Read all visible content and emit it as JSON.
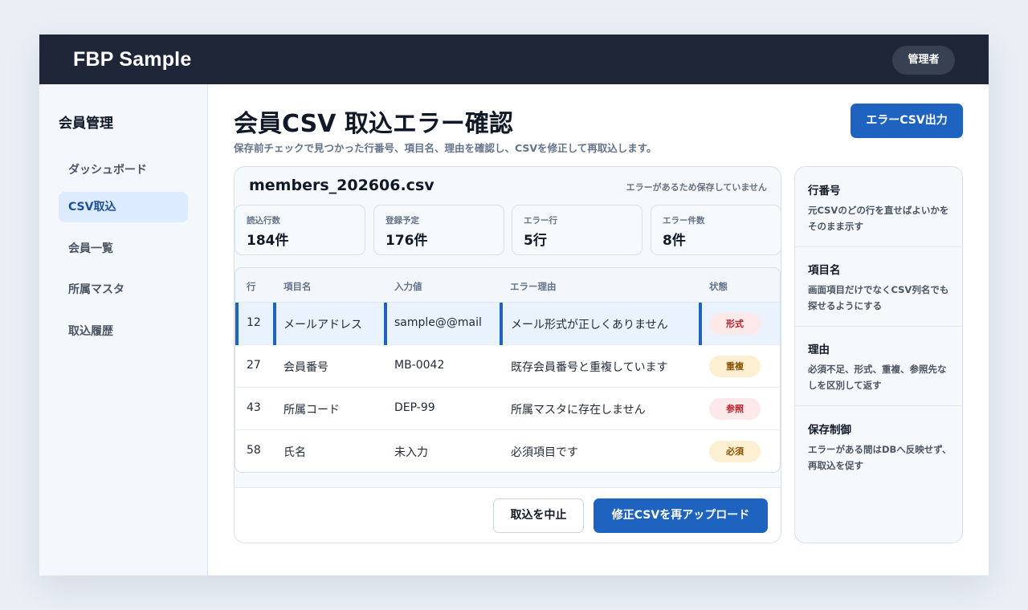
{
  "header": {
    "brand": "FBP Sample",
    "role": "管理者"
  },
  "sidebar": {
    "title": "会員管理",
    "items": [
      {
        "label": "ダッシュボード",
        "active": false
      },
      {
        "label": "CSV取込",
        "active": true
      },
      {
        "label": "会員一覧",
        "active": false
      },
      {
        "label": "所属マスタ",
        "active": false
      },
      {
        "label": "取込履歴",
        "active": false
      }
    ]
  },
  "page": {
    "title": "会員CSV 取込エラー確認",
    "subtitle": "保存前チェックで見つかった行番号、項目名、理由を確認し、CSVを修正して再取込します。",
    "export_label": "エラーCSV出力"
  },
  "file": {
    "name": "members_202606.csv",
    "note": "エラーがあるため保存していません"
  },
  "stats": [
    {
      "label": "読込行数",
      "value": "184件"
    },
    {
      "label": "登録予定",
      "value": "176件"
    },
    {
      "label": "エラー行",
      "value": "5行"
    },
    {
      "label": "エラー件数",
      "value": "8件"
    }
  ],
  "table": {
    "headers": [
      "行",
      "項目名",
      "入力値",
      "エラー理由",
      "状態"
    ],
    "rows": [
      {
        "row": "12",
        "field": "メールアドレス",
        "value": "sample@@mail",
        "reason": "メール形式が正しくありません",
        "status": "形式",
        "status_tone": "red"
      },
      {
        "row": "27",
        "field": "会員番号",
        "value": "MB-0042",
        "reason": "既存会員番号と重複しています",
        "status": "重複",
        "status_tone": "amber"
      },
      {
        "row": "43",
        "field": "所属コード",
        "value": "DEP-99",
        "reason": "所属マスタに存在しません",
        "status": "参照",
        "status_tone": "red"
      },
      {
        "row": "58",
        "field": "氏名",
        "value": "未入力",
        "reason": "必須項目です",
        "status": "必須",
        "status_tone": "amber"
      }
    ]
  },
  "actions": {
    "cancel_label": "取込を中止",
    "reupload_label": "修正CSVを再アップロード"
  },
  "help": [
    {
      "title": "行番号",
      "desc": "元CSVのどの行を直せばよいかをそのまま示す"
    },
    {
      "title": "項目名",
      "desc": "画面項目だけでなくCSV列名でも探せるようにする"
    },
    {
      "title": "理由",
      "desc": "必須不足、形式、重複、参照先なしを区別して返す"
    },
    {
      "title": "保存制御",
      "desc": "エラーがある間はDBへ反映せず、再取込を促す"
    }
  ],
  "colors": {
    "primary": "#1f63c1",
    "topbar": "#1e2637",
    "active_nav_bg": "#dcebfd",
    "badge_red_bg": "#fde8ea",
    "badge_red_text": "#b4232a",
    "badge_amber_bg": "#fdf0d2",
    "badge_amber_text": "#8a5300"
  }
}
